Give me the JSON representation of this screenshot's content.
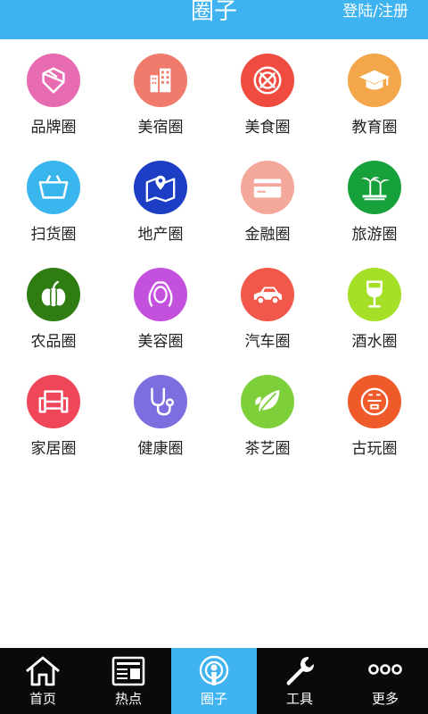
{
  "header": {
    "title": "圈子",
    "login_label": "登陆/注册"
  },
  "categories": [
    {
      "label": "品牌圈",
      "icon": "diamond-icon",
      "color": "#e76bb1"
    },
    {
      "label": "美宿圈",
      "icon": "buildings-icon",
      "color": "#f07a6b"
    },
    {
      "label": "美食圈",
      "icon": "food-plate-icon",
      "color": "#ef4b3f"
    },
    {
      "label": "教育圈",
      "icon": "graduation-cap-icon",
      "color": "#f3a64a"
    },
    {
      "label": "扫货圈",
      "icon": "shopping-basket-icon",
      "color": "#3ab6ef"
    },
    {
      "label": "地产圈",
      "icon": "map-location-icon",
      "color": "#1c3ec4"
    },
    {
      "label": "金融圈",
      "icon": "bank-card-icon",
      "color": "#f3a89a"
    },
    {
      "label": "旅游圈",
      "icon": "palm-tree-icon",
      "color": "#16a13a"
    },
    {
      "label": "农品圈",
      "icon": "pumpkin-icon",
      "color": "#2f7d12"
    },
    {
      "label": "美容圈",
      "icon": "woman-face-icon",
      "color": "#c451de"
    },
    {
      "label": "汽车圈",
      "icon": "car-icon",
      "color": "#f2574b"
    },
    {
      "label": "酒水圈",
      "icon": "wine-glass-icon",
      "color": "#a6df28"
    },
    {
      "label": "家居圈",
      "icon": "sofa-icon",
      "color": "#f0465a"
    },
    {
      "label": "健康圈",
      "icon": "stethoscope-icon",
      "color": "#7d6ee0"
    },
    {
      "label": "茶艺圈",
      "icon": "tea-leaf-icon",
      "color": "#7ed03a"
    },
    {
      "label": "古玩圈",
      "icon": "antique-seal-icon",
      "color": "#ef5a2a"
    }
  ],
  "tabs": [
    {
      "label": "首页",
      "icon": "home-icon",
      "active": false
    },
    {
      "label": "热点",
      "icon": "news-icon",
      "active": false
    },
    {
      "label": "圈子",
      "icon": "broadcast-icon",
      "active": true
    },
    {
      "label": "工具",
      "icon": "wrench-icon",
      "active": false
    },
    {
      "label": "更多",
      "icon": "more-dots-icon",
      "active": false
    }
  ],
  "colors": {
    "header_bg": "#3fb3ef",
    "tabbar_bg": "#0a0a0a",
    "tab_active_bg": "#3fb3ef"
  }
}
